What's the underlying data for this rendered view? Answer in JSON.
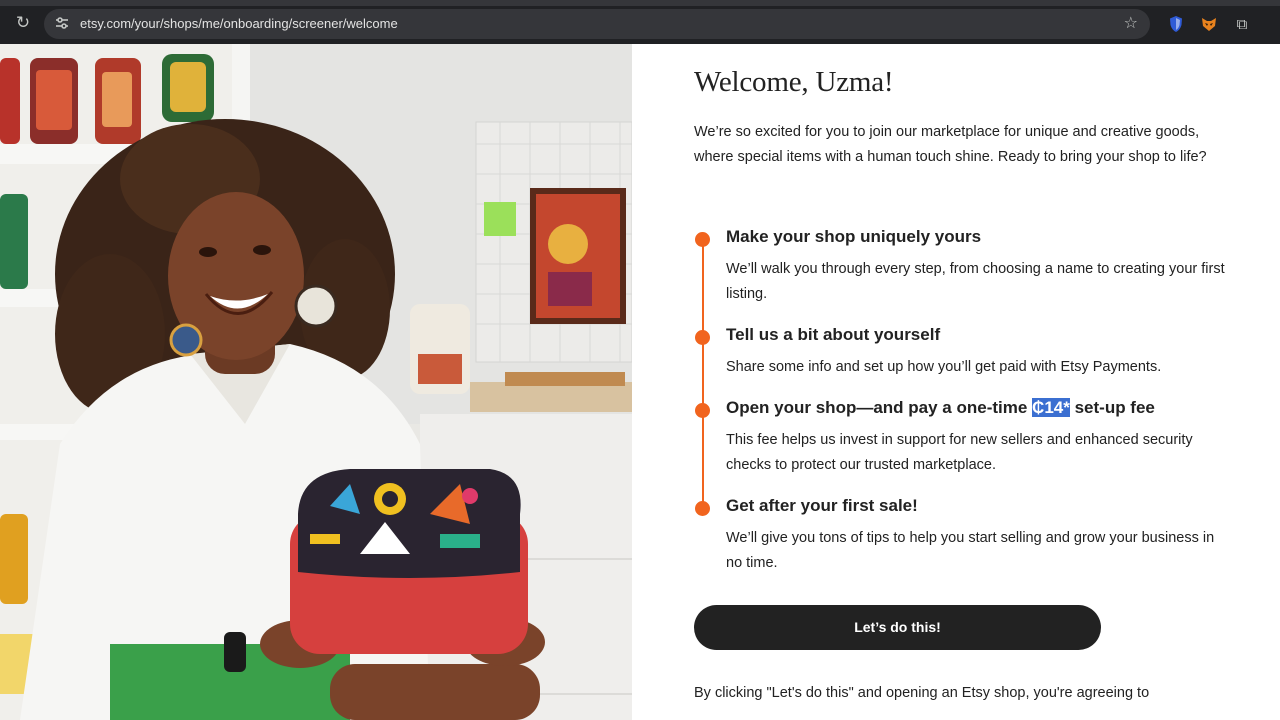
{
  "browser": {
    "url": "etsy.com/your/shops/me/onboarding/screener/welcome",
    "icons": [
      "reload-icon",
      "site-settings-icon",
      "bookmark-star-icon",
      "extension-shield-icon",
      "extension-fox-icon",
      "extensions-puzzle-icon"
    ]
  },
  "page": {
    "heading": "Welcome, Uzma!",
    "intro": "We’re so excited for you to join our marketplace for unique and creative goods, where special items with a human touch shine. Ready to bring your shop to life?",
    "steps": [
      {
        "title": "Make your shop uniquely yours",
        "description": "We’ll walk you through every step, from choosing a name to creating your first listing."
      },
      {
        "title": "Tell us a bit about yourself",
        "description": "Share some info and set up how you’ll get paid with Etsy Payments."
      },
      {
        "title_before": "Open your shop—and pay a one-time ",
        "title_highlight": "₵14*",
        "title_after": " set-up fee",
        "description": "This fee helps us invest in support for new sellers and enhanced security checks to protect our trusted marketplace."
      },
      {
        "title": "Get after your first sale!",
        "description": "We’ll give you tons of tips to help you start selling and grow your business in no time."
      }
    ],
    "cta_label": "Let’s do this!",
    "legal_text": "By clicking \"Let's do this\" and opening an Etsy shop, you're agreeing to"
  },
  "colors": {
    "accent": "#f1641e",
    "button": "#222222",
    "text_highlight": "#3b6fd1"
  }
}
